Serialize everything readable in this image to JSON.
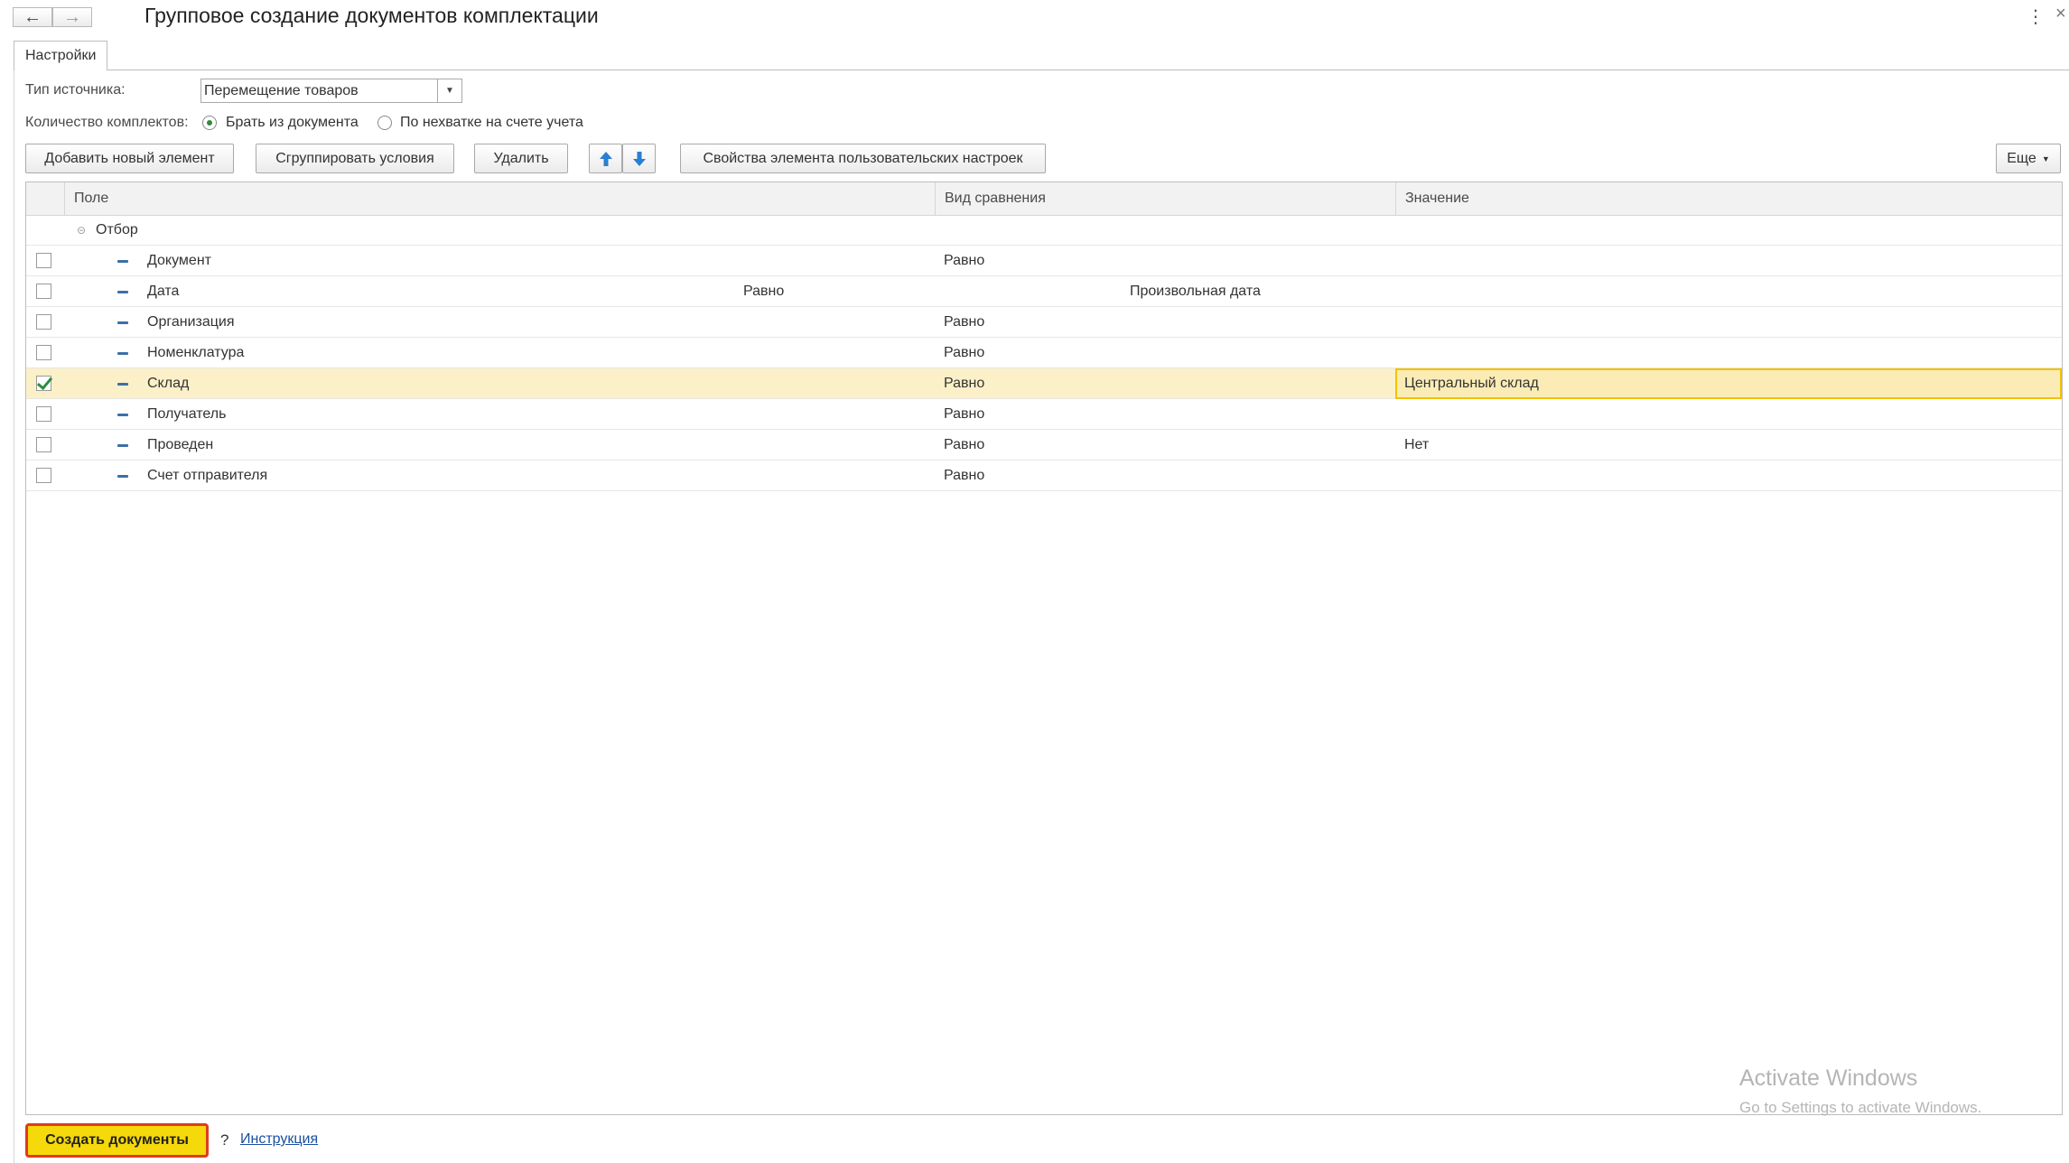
{
  "window": {
    "title": "Групповое создание документов комплектации"
  },
  "tabs": [
    {
      "label": "Настройки"
    }
  ],
  "form": {
    "source_type_label": "Тип источника:",
    "source_type_value": "Перемещение товаров",
    "kits_label": "Количество комплектов:",
    "radio_options": [
      {
        "label": "Брать из документа",
        "selected": true
      },
      {
        "label": "По нехватке на счете учета",
        "selected": false
      }
    ]
  },
  "toolbar": {
    "add_label": "Добавить новый элемент",
    "group_label": "Сгруппировать условия",
    "delete_label": "Удалить",
    "properties_label": "Свойства элемента пользовательских настроек",
    "more_label": "Еще"
  },
  "table": {
    "columns": [
      "Поле",
      "Вид сравнения",
      "Значение"
    ],
    "group": "Отбор",
    "rows": [
      {
        "field": "Документ",
        "comparison": "Равно",
        "value": "",
        "checked": false
      },
      {
        "field": "Дата",
        "comparison": "Равно",
        "value": "Произвольная дата",
        "checked": false
      },
      {
        "field": "Организация",
        "comparison": "Равно",
        "value": "",
        "checked": false
      },
      {
        "field": "Номенклатура",
        "comparison": "Равно",
        "value": "",
        "checked": false
      },
      {
        "field": "Склад",
        "comparison": "Равно",
        "value": "Центральный склад",
        "checked": true
      },
      {
        "field": "Получатель",
        "comparison": "Равно",
        "value": "",
        "checked": false
      },
      {
        "field": "Проведен",
        "comparison": "Равно",
        "value": "Нет",
        "checked": false
      },
      {
        "field": "Счет отправителя",
        "comparison": "Равно",
        "value": "",
        "checked": false
      }
    ]
  },
  "watermark": {
    "line1": "Activate Windows",
    "line2": "Go to Settings to activate Windows."
  },
  "footer": {
    "create_label": "Создать документы",
    "help_symbol": "?",
    "instruction_label": "Инструкция"
  },
  "colors": {
    "selected_row": "#fbf0c7",
    "accent_yellow": "#f5d90a",
    "highlight_border": "#e03a1e",
    "check_green": "#2e8b3d",
    "arrow_blue": "#2a7fd0"
  }
}
